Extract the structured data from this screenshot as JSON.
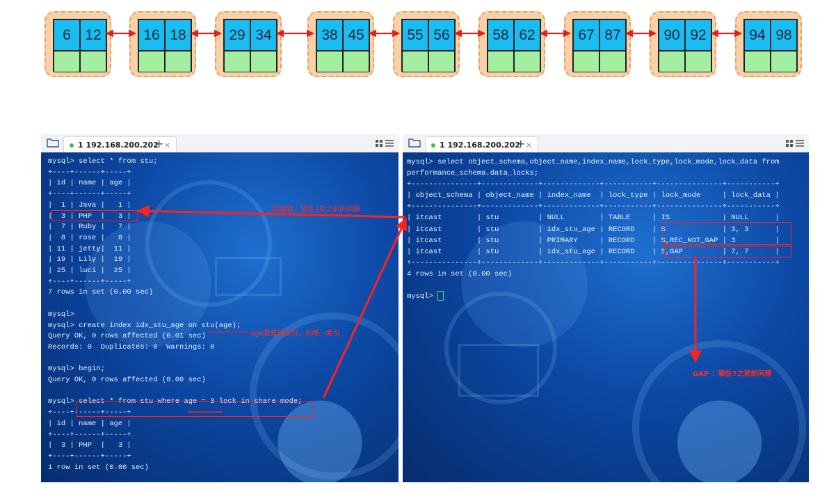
{
  "chain": {
    "nodes": [
      {
        "k1": "6",
        "k2": "12"
      },
      {
        "k1": "16",
        "k2": "18"
      },
      {
        "k1": "29",
        "k2": "34"
      },
      {
        "k1": "38",
        "k2": "45"
      },
      {
        "k1": "55",
        "k2": "56"
      },
      {
        "k1": "58",
        "k2": "62"
      },
      {
        "k1": "67",
        "k2": "87"
      },
      {
        "k1": "90",
        "k2": "92"
      },
      {
        "k1": "94",
        "k2": "98"
      }
    ]
  },
  "left_terminal": {
    "tab_label": "1 192.168.200.202",
    "tab_close": "×",
    "new_tab": "+",
    "lines": [
      "mysql> select * from stu;",
      "+----+------+-----+",
      "| id | name | age |",
      "+----+------+-----+",
      "|  1 | Java |   1 |",
      "|  3 | PHP  |   3 |",
      "|  7 | Ruby |   7 |",
      "|  8 | rose |   8 |",
      "| 11 | jetty|  11 |",
      "| 19 | Lily |  19 |",
      "| 25 | luci |  25 |",
      "+----+------+-----+",
      "7 rows in set (0.00 sec)",
      "",
      "mysql>",
      "mysql> create index idx_stu_age on stu(age);",
      "Query OK, 0 rows affected (0.01 sec)",
      "Records: 0  Duplicates: 0  Warnings: 0",
      "",
      "mysql> begin;",
      "Query OK, 0 rows affected (0.00 sec)",
      "",
      "mysql> select * from stu where age = 3 lock in share mode;",
      "+----+------+-----+",
      "| id | name | age |",
      "+----+------+-----+",
      "|  3 | PHP  |   3 |",
      "+----+------+-----+",
      "1 row in set (0.00 sec)"
    ]
  },
  "right_terminal": {
    "tab_label": "1 192.168.200.202",
    "tab_close": "×",
    "new_tab": "+",
    "lines": [
      "mysql> select object_schema,object_name,index_name,lock_type,lock_mode,lock_data from",
      "performance_schema.data_locks;",
      "+---------------+-------------+-------------+-----------+---------------+-----------+",
      "| object_schema | object_name | index_name  | lock_type | lock_mode     | lock_data |",
      "+---------------+-------------+-------------+-----------+---------------+-----------+",
      "| itcast        | stu         | NULL        | TABLE     | IS            | NULL      |",
      "| itcast        | stu         | idx_stu_age | RECORD    | S             | 3, 3      |",
      "| itcast        | stu         | PRIMARY     | RECORD    | S,REC_NOT_GAP | 3         |",
      "| itcast        | stu         | idx_stu_age | RECORD    | S,GAP         | 7, 7      |",
      "+---------------+-------------+-------------+-----------+---------------+-----------+",
      "4 rows in set (0.00 sec)",
      "",
      "mysql> "
    ]
  },
  "annotations": {
    "lock_range": "临键锁，锁住3及之前的间隙",
    "age_index": "age是普通索引，非唯一索引",
    "gap_lock": "GAP ：锁住7之前的间隙"
  },
  "colors": {
    "arrow": "#ff2020",
    "key_cell": "#19bdf2",
    "pointer_cell": "#a4eea2",
    "node_bg": "#f9d1a8"
  }
}
